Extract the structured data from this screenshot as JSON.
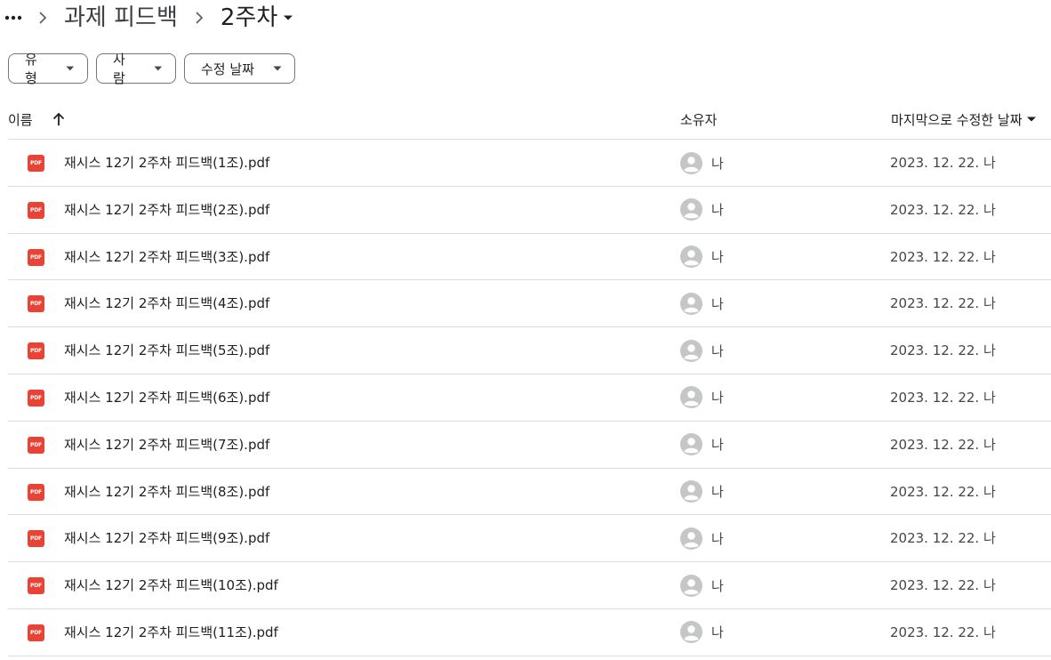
{
  "breadcrumb": {
    "items": [
      {
        "label": "과제 피드백"
      },
      {
        "label": "2주차"
      }
    ]
  },
  "filters": [
    {
      "label": "유형"
    },
    {
      "label": "사람"
    },
    {
      "label": "수정 날짜"
    }
  ],
  "table": {
    "columns": {
      "name": "이름",
      "owner": "소유자",
      "modified": "마지막으로 수정한 날짜"
    },
    "icon_label": "PDF",
    "rows": [
      {
        "name": "재시스 12기 2주차 피드백(1조).pdf",
        "owner": "나",
        "modified": "2023. 12. 22. 나"
      },
      {
        "name": "재시스 12기 2주차 피드백(2조).pdf",
        "owner": "나",
        "modified": "2023. 12. 22. 나"
      },
      {
        "name": "재시스 12기 2주차 피드백(3조).pdf",
        "owner": "나",
        "modified": "2023. 12. 22. 나"
      },
      {
        "name": "재시스 12기 2주차 피드백(4조).pdf",
        "owner": "나",
        "modified": "2023. 12. 22. 나"
      },
      {
        "name": "재시스 12기 2주차 피드백(5조).pdf",
        "owner": "나",
        "modified": "2023. 12. 22. 나"
      },
      {
        "name": "재시스 12기 2주차 피드백(6조).pdf",
        "owner": "나",
        "modified": "2023. 12. 22. 나"
      },
      {
        "name": "재시스 12기 2주차 피드백(7조).pdf",
        "owner": "나",
        "modified": "2023. 12. 22. 나"
      },
      {
        "name": "재시스 12기 2주차 피드백(8조).pdf",
        "owner": "나",
        "modified": "2023. 12. 22. 나"
      },
      {
        "name": "재시스 12기 2주차 피드백(9조).pdf",
        "owner": "나",
        "modified": "2023. 12. 22. 나"
      },
      {
        "name": "재시스 12기 2주차 피드백(10조).pdf",
        "owner": "나",
        "modified": "2023. 12. 22. 나"
      },
      {
        "name": "재시스 12기 2주차 피드백(11조).pdf",
        "owner": "나",
        "modified": "2023. 12. 22. 나"
      }
    ]
  },
  "colors": {
    "pdf_red": "#ea4335",
    "divider": "#dadce0",
    "text_primary": "#1f1f1f",
    "text_secondary": "#444746"
  }
}
